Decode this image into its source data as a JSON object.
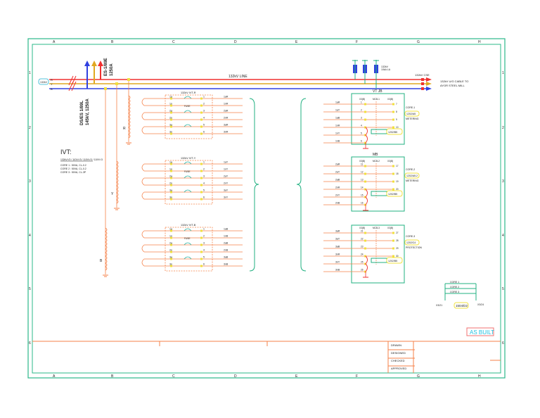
{
  "frame": {
    "columns": [
      "A",
      "B",
      "C",
      "D",
      "E",
      "F",
      "G",
      "H"
    ],
    "rows": [
      "1",
      "2",
      "3",
      "4",
      "5",
      "6"
    ],
    "border_color": "#2bb88a"
  },
  "colors": {
    "red": "#f03030",
    "yellow": "#e0a820",
    "blue": "#3040e0",
    "orange": "#f5824a",
    "green": "#20b080",
    "highlight": "#f0e040"
  },
  "busbar": {
    "phases": [
      "R",
      "Y",
      "B"
    ],
    "line_label": "132kV LINE",
    "cse_label": "132kV CSE",
    "dest_label_1": "132kV U/G CABLE TO",
    "dest_label_2": "AYOR STEEL MILL",
    "incomer_tag": "132kV",
    "ds_label_1": "DS/ES 1/89L",
    "ds_label_2": "145kV, 1250A",
    "es_label_1": "ES-1/89E",
    "es_label_2": "1250A",
    "la_label_1": "132kV",
    "la_label_2": "10kA LA"
  },
  "ivt_note": {
    "title": "IVT:",
    "ratio": "132kV/√3 / 110V/√3 / 110V/√3 / 110V/√3",
    "cores": [
      "CORE 1 : 50VA, CL-0.2",
      "CORE 2 : 50VA, CL-0.2",
      "CORE 3 : 50VA, CL-3P"
    ]
  },
  "ivts": [
    {
      "phase": "R",
      "title": "132kV IVT-R",
      "fuse": "FUSE",
      "left": [
        "1a",
        "1n",
        "2a",
        "2n",
        "3a",
        "3n"
      ],
      "right": [
        "1",
        "2",
        "3",
        "4",
        "5",
        "6"
      ],
      "outputs": [
        "1aR",
        "1nR",
        "2aR",
        "2nR",
        "3aR",
        "3nR"
      ]
    },
    {
      "phase": "Y",
      "title": "132kV IVT-Y",
      "fuse": "FUSE",
      "left": [
        "1a",
        "1n",
        "2a",
        "2n",
        "3a",
        "3n"
      ],
      "right": [
        "1",
        "2",
        "3",
        "4",
        "5",
        "6"
      ],
      "outputs": [
        "1aY",
        "1nY",
        "2aY",
        "2nY",
        "3aY",
        "3nY"
      ]
    },
    {
      "phase": "B",
      "title": "132kV IVT-B",
      "fuse": "FUSE",
      "left": [
        "1a",
        "1n",
        "2a",
        "2n",
        "3a",
        "3n"
      ],
      "right": [
        "1",
        "2",
        "3",
        "4",
        "5",
        "6"
      ],
      "outputs": [
        "1aB",
        "1nB",
        "2aB",
        "2nB",
        "3aB",
        "3nB"
      ]
    }
  ],
  "boxes": [
    {
      "title": "VT JB",
      "x3a": "X3(B)",
      "mcb": "MCB-1",
      "x3b": "X3(B)",
      "wires": [
        "1aR",
        "1aY",
        "1aB",
        "1nR",
        "1nY",
        "1nB"
      ],
      "terms": [
        "1",
        "2",
        "3",
        "4",
        "5",
        "6"
      ],
      "out_terms": [
        "7",
        "8",
        "9",
        "10"
      ],
      "core": "CORE-1",
      "dest": "1202/A5",
      "use": "METERING",
      "tag": "1202/B5"
    },
    {
      "title": "MB",
      "x3a": "X3(B)",
      "mcb": "MCB-2",
      "x3b": "X3(B)",
      "wires": [
        "2aR",
        "2aY",
        "2aB",
        "2nR",
        "2nY",
        "2nB"
      ],
      "terms": [
        "11",
        "12",
        "13",
        "14",
        "15",
        "16"
      ],
      "out_terms": [
        "17",
        "18",
        "19",
        "20"
      ],
      "core": "CORE-2",
      "dest": "1202/A5.2",
      "use": "METERING",
      "tag": "1202/B5"
    },
    {
      "title": "",
      "x3a": "X3(B)",
      "mcb": "MCB-3",
      "x3b": "X3(B)",
      "wires": [
        "3aR",
        "3aY",
        "3aB",
        "3nR",
        "3nY",
        "3nB"
      ],
      "terms": [
        "21",
        "22",
        "23",
        "24",
        "25",
        "26"
      ],
      "out_terms": [
        "27",
        "28",
        "29",
        "30"
      ],
      "core": "CORE-3",
      "dest": "1202/C4",
      "use": "PROTECTION",
      "tag": "1202/B5"
    }
  ],
  "legend_box": {
    "items": [
      "CORE 1",
      "CORE 2",
      "CORE 3"
    ],
    "left": "X3/21",
    "right": "X3/24",
    "ref": "1504/D2"
  },
  "stamp": "AS BUILT",
  "title_block": {
    "rows": [
      "DRAWN",
      "DESIGNED",
      "CHECKED",
      "APPROVED"
    ]
  }
}
